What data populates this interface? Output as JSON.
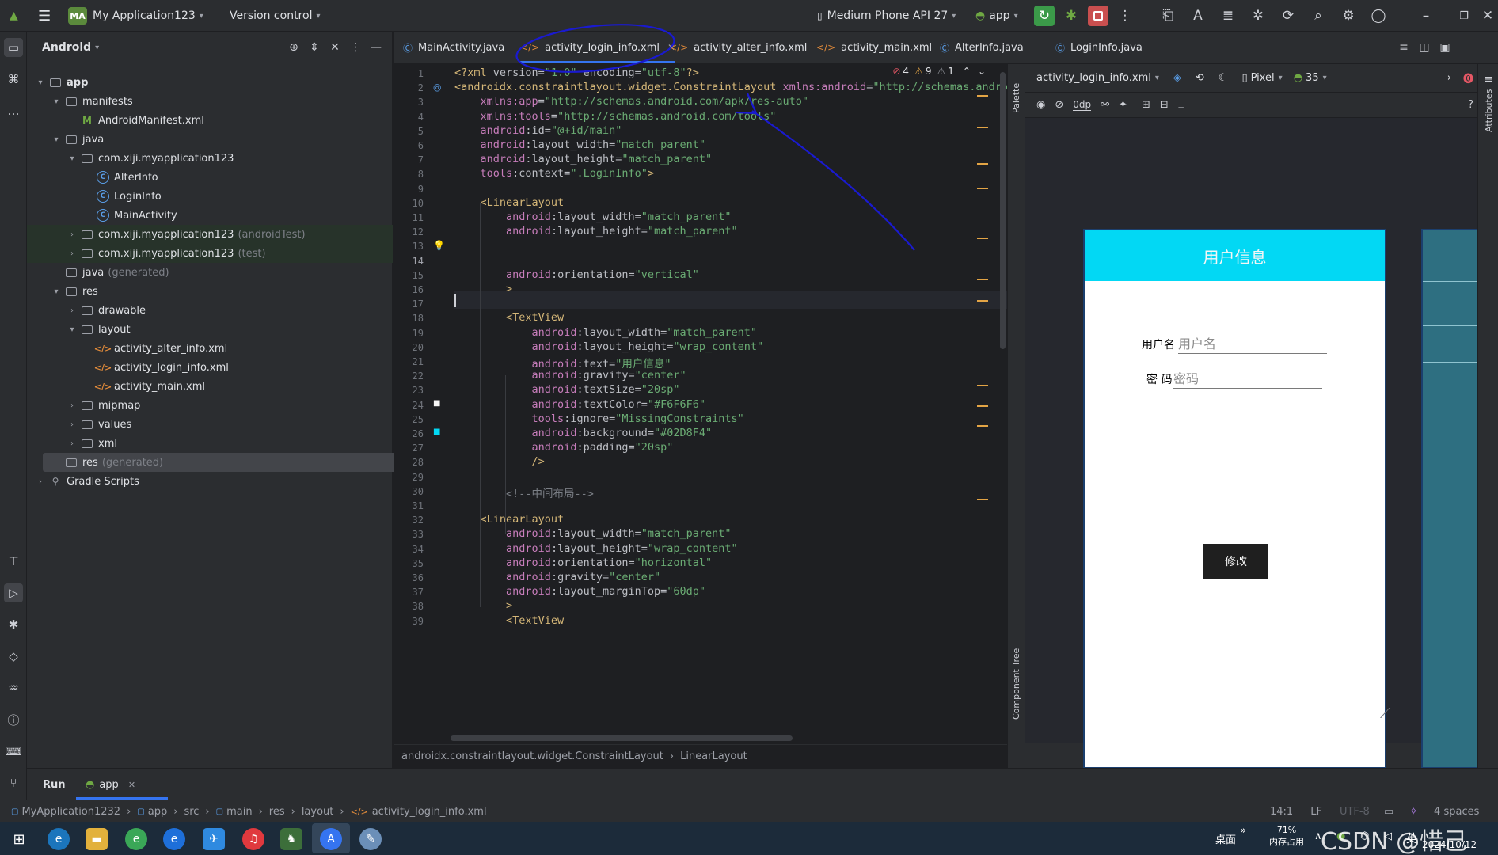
{
  "titlebar": {
    "project_badge": "MA",
    "project_name": "My Application123",
    "vcs": "Version control",
    "device": "Medium Phone API 27",
    "run_config": "app"
  },
  "project_panel": {
    "title": "Android",
    "tree": [
      {
        "label": "app",
        "suffix": "",
        "indent": 0,
        "arrow": "▾",
        "icon": "folder",
        "bold": true
      },
      {
        "label": "manifests",
        "suffix": "",
        "indent": 1,
        "arrow": "▾",
        "icon": "folder"
      },
      {
        "label": "AndroidManifest.xml",
        "suffix": "",
        "indent": 2,
        "arrow": "",
        "icon": "manifest"
      },
      {
        "label": "java",
        "suffix": "",
        "indent": 1,
        "arrow": "▾",
        "icon": "folder"
      },
      {
        "label": "com.xiji.myapplication123",
        "suffix": "",
        "indent": 2,
        "arrow": "▾",
        "icon": "folder"
      },
      {
        "label": "AlterInfo",
        "suffix": "",
        "indent": 3,
        "arrow": "",
        "icon": "class"
      },
      {
        "label": "LoginInfo",
        "suffix": "",
        "indent": 3,
        "arrow": "",
        "icon": "class"
      },
      {
        "label": "MainActivity",
        "suffix": "",
        "indent": 3,
        "arrow": "",
        "icon": "class"
      },
      {
        "label": "com.xiji.myapplication123",
        "suffix": "(androidTest)",
        "indent": 2,
        "arrow": "›",
        "icon": "folder",
        "green": true
      },
      {
        "label": "com.xiji.myapplication123",
        "suffix": "(test)",
        "indent": 2,
        "arrow": "›",
        "icon": "folder",
        "green": true
      },
      {
        "label": "java",
        "suffix": "(generated)",
        "indent": 1,
        "arrow": "",
        "icon": "folder"
      },
      {
        "label": "res",
        "suffix": "",
        "indent": 1,
        "arrow": "▾",
        "icon": "folder"
      },
      {
        "label": "drawable",
        "suffix": "",
        "indent": 2,
        "arrow": "›",
        "icon": "folder"
      },
      {
        "label": "layout",
        "suffix": "",
        "indent": 2,
        "arrow": "▾",
        "icon": "folder"
      },
      {
        "label": "activity_alter_info.xml",
        "suffix": "",
        "indent": 3,
        "arrow": "",
        "icon": "xml"
      },
      {
        "label": "activity_login_info.xml",
        "suffix": "",
        "indent": 3,
        "arrow": "",
        "icon": "xml"
      },
      {
        "label": "activity_main.xml",
        "suffix": "",
        "indent": 3,
        "arrow": "",
        "icon": "xml"
      },
      {
        "label": "mipmap",
        "suffix": "",
        "indent": 2,
        "arrow": "›",
        "icon": "folder"
      },
      {
        "label": "values",
        "suffix": "",
        "indent": 2,
        "arrow": "›",
        "icon": "folder"
      },
      {
        "label": "xml",
        "suffix": "",
        "indent": 2,
        "arrow": "›",
        "icon": "folder"
      },
      {
        "label": "res",
        "suffix": "(generated)",
        "indent": 1,
        "arrow": "",
        "icon": "folder",
        "selected": true
      },
      {
        "label": "Gradle Scripts",
        "suffix": "",
        "indent": 0,
        "arrow": "›",
        "icon": "gradle"
      }
    ]
  },
  "tabs": [
    {
      "label": "MainActivity.java",
      "icon": "class"
    },
    {
      "label": "activity_login_info.xml",
      "icon": "xml",
      "active": true
    },
    {
      "label": "activity_alter_info.xml",
      "icon": "xml"
    },
    {
      "label": "activity_main.xml",
      "icon": "xml"
    },
    {
      "label": "AlterInfo.java",
      "icon": "class"
    },
    {
      "label": "LoginInfo.java",
      "icon": "class"
    }
  ],
  "editor": {
    "errors": "4",
    "warnings": "9",
    "weak_warnings": "1",
    "current_line": 14,
    "lines": [
      [
        [
          "tag",
          "<?xml "
        ],
        [
          "attr",
          "version="
        ],
        [
          "str",
          "\"1.0\""
        ],
        [
          "attr",
          " encoding="
        ],
        [
          "str",
          "\"utf-8\""
        ],
        [
          "tag",
          "?>"
        ]
      ],
      [
        [
          "tag",
          "<androidx.constraintlayout.widget.ConstraintLayout "
        ],
        [
          "ns",
          "xmlns:android"
        ],
        [
          "attr",
          "="
        ],
        [
          "str",
          "\"http://schemas.androi"
        ]
      ],
      [
        [
          "attr",
          "    "
        ],
        [
          "ns",
          "xmlns:app"
        ],
        [
          "attr",
          "="
        ],
        [
          "str",
          "\"http://schemas.android.com/apk/res-auto\""
        ]
      ],
      [
        [
          "attr",
          "    "
        ],
        [
          "ns",
          "xmlns:tools"
        ],
        [
          "attr",
          "="
        ],
        [
          "str",
          "\"http://schemas.android.com/tools\""
        ]
      ],
      [
        [
          "attr",
          "    "
        ],
        [
          "ns",
          "android"
        ],
        [
          "attr",
          ":id="
        ],
        [
          "str",
          "\"@+id/main\""
        ]
      ],
      [
        [
          "attr",
          "    "
        ],
        [
          "ns",
          "android"
        ],
        [
          "attr",
          ":layout_width="
        ],
        [
          "str",
          "\"match_parent\""
        ]
      ],
      [
        [
          "attr",
          "    "
        ],
        [
          "ns",
          "android"
        ],
        [
          "attr",
          ":layout_height="
        ],
        [
          "str",
          "\"match_parent\""
        ]
      ],
      [
        [
          "attr",
          "    "
        ],
        [
          "ns",
          "tools"
        ],
        [
          "attr",
          ":context="
        ],
        [
          "str",
          "\".LoginInfo\""
        ],
        [
          "tag",
          ">"
        ]
      ],
      [
        [
          "attr",
          ""
        ]
      ],
      [
        [
          "attr",
          "    "
        ],
        [
          "tag",
          "<LinearLayout"
        ]
      ],
      [
        [
          "attr",
          "        "
        ],
        [
          "ns",
          "android"
        ],
        [
          "attr",
          ":layout_width="
        ],
        [
          "str",
          "\"match_parent\""
        ]
      ],
      [
        [
          "attr",
          "        "
        ],
        [
          "ns",
          "android"
        ],
        [
          "attr",
          ":layout_height="
        ],
        [
          "str",
          "\"match_parent\""
        ]
      ],
      [
        [
          "attr",
          ""
        ]
      ],
      [
        [
          "attr",
          ""
        ]
      ],
      [
        [
          "attr",
          "        "
        ],
        [
          "ns",
          "android"
        ],
        [
          "attr",
          ":orientation="
        ],
        [
          "str",
          "\"vertical\""
        ]
      ],
      [
        [
          "attr",
          "        "
        ],
        [
          "tag",
          ">"
        ]
      ],
      [
        [
          "attr",
          ""
        ]
      ],
      [
        [
          "attr",
          "        "
        ],
        [
          "tag",
          "<TextView"
        ]
      ],
      [
        [
          "attr",
          "            "
        ],
        [
          "ns",
          "android"
        ],
        [
          "attr",
          ":layout_width="
        ],
        [
          "str",
          "\"match_parent\""
        ]
      ],
      [
        [
          "attr",
          "            "
        ],
        [
          "ns",
          "android"
        ],
        [
          "attr",
          ":layout_height="
        ],
        [
          "str",
          "\"wrap_content\""
        ]
      ],
      [
        [
          "attr",
          "            "
        ],
        [
          "ns",
          "android"
        ],
        [
          "attr",
          ":text="
        ],
        [
          "str",
          "\"用户信息\""
        ]
      ],
      [
        [
          "attr",
          "            "
        ],
        [
          "ns",
          "android"
        ],
        [
          "attr",
          ":gravity="
        ],
        [
          "str",
          "\"center\""
        ]
      ],
      [
        [
          "attr",
          "            "
        ],
        [
          "ns",
          "android"
        ],
        [
          "attr",
          ":textSize="
        ],
        [
          "str",
          "\"20sp\""
        ]
      ],
      [
        [
          "attr",
          "            "
        ],
        [
          "ns",
          "android"
        ],
        [
          "attr",
          ":textColor="
        ],
        [
          "str",
          "\"#F6F6F6\""
        ]
      ],
      [
        [
          "attr",
          "            "
        ],
        [
          "ns",
          "tools"
        ],
        [
          "attr",
          ":ignore="
        ],
        [
          "str",
          "\"MissingConstraints\""
        ]
      ],
      [
        [
          "attr",
          "            "
        ],
        [
          "ns",
          "android"
        ],
        [
          "attr",
          ":background="
        ],
        [
          "str",
          "\"#02D8F4\""
        ]
      ],
      [
        [
          "attr",
          "            "
        ],
        [
          "ns",
          "android"
        ],
        [
          "attr",
          ":padding="
        ],
        [
          "str",
          "\"20sp\""
        ]
      ],
      [
        [
          "attr",
          "            "
        ],
        [
          "tag",
          "/>"
        ]
      ],
      [
        [
          "attr",
          ""
        ]
      ],
      [
        [
          "attr",
          "        "
        ],
        [
          "cmt",
          "<!--中间布局-->"
        ]
      ],
      [
        [
          "attr",
          ""
        ]
      ],
      [
        [
          "attr",
          "    "
        ],
        [
          "tag",
          "<LinearLayout"
        ]
      ],
      [
        [
          "attr",
          "        "
        ],
        [
          "ns",
          "android"
        ],
        [
          "attr",
          ":layout_width="
        ],
        [
          "str",
          "\"match_parent\""
        ]
      ],
      [
        [
          "attr",
          "        "
        ],
        [
          "ns",
          "android"
        ],
        [
          "attr",
          ":layout_height="
        ],
        [
          "str",
          "\"wrap_content\""
        ]
      ],
      [
        [
          "attr",
          "        "
        ],
        [
          "ns",
          "android"
        ],
        [
          "attr",
          ":orientation="
        ],
        [
          "str",
          "\"horizontal\""
        ]
      ],
      [
        [
          "attr",
          "        "
        ],
        [
          "ns",
          "android"
        ],
        [
          "attr",
          ":gravity="
        ],
        [
          "str",
          "\"center\""
        ]
      ],
      [
        [
          "attr",
          "        "
        ],
        [
          "ns",
          "android"
        ],
        [
          "attr",
          ":layout_marginTop="
        ],
        [
          "str",
          "\"60dp\""
        ]
      ],
      [
        [
          "attr",
          "        "
        ],
        [
          "tag",
          ">"
        ]
      ],
      [
        [
          "attr",
          "        "
        ],
        [
          "tag",
          "<TextView"
        ]
      ]
    ]
  },
  "breadcrumb": [
    "androidx.constraintlayout.widget.ConstraintLayout",
    "LinearLayout"
  ],
  "design": {
    "file": "activity_login_info.xml",
    "device": "Pixel",
    "api": "35",
    "margin": "0dp",
    "palette_label": "Palette",
    "component_tree_label": "Component Tree",
    "attributes_label": "Attributes",
    "preview": {
      "header": "用户信息",
      "username_label": "用户名",
      "username_hint": "用户名",
      "password_label": "密 码",
      "password_hint": "密码",
      "button": "修改"
    },
    "colors": {
      "header_bg": "#02D8F4",
      "header_text": "#F6F6F6"
    }
  },
  "runbar": {
    "label": "Run",
    "tab": "app"
  },
  "statusbar": {
    "path": [
      "MyApplication1232",
      "app",
      "src",
      "main",
      "res",
      "layout",
      "activity_login_info.xml"
    ],
    "position": "14:1",
    "line_sep": "LF",
    "encoding": "UTF-8",
    "indent": "4 spaces"
  },
  "taskbar": {
    "desktop": "桌面",
    "memory_pct": "71%",
    "memory_label": "内存占用",
    "ime": "英",
    "date": "2024/10/12",
    "watermark": "CSDN @惜己"
  }
}
